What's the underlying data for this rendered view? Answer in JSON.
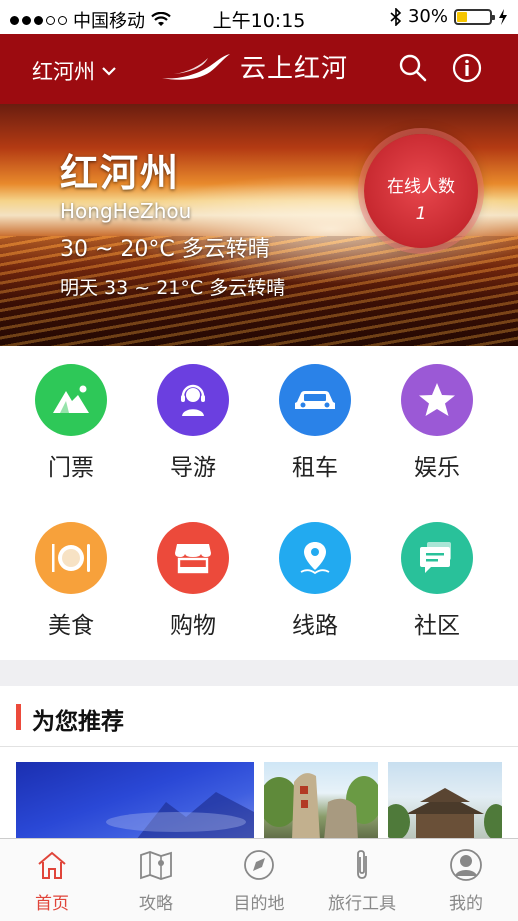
{
  "status_bar": {
    "carrier": "中国移动",
    "time": "上午10:15",
    "battery": "30%"
  },
  "header": {
    "city": "红河州",
    "app_title": "云上红河"
  },
  "banner": {
    "city_name": "红河州",
    "pinyin": "HongHeZhou",
    "today_weather": "30 ~ 20°C 多云转晴",
    "tomorrow_weather": "明天 33 ~ 21°C 多云转晴",
    "online_label": "在线人数",
    "online_count": "1"
  },
  "services": [
    {
      "label": "门票",
      "icon": "mountain-icon",
      "color": "#2ec858"
    },
    {
      "label": "导游",
      "icon": "guide-headset-icon",
      "color": "#6b3fe0"
    },
    {
      "label": "租车",
      "icon": "car-icon",
      "color": "#2a82e8"
    },
    {
      "label": "娱乐",
      "icon": "star-icon",
      "color": "#9b59d6"
    },
    {
      "label": "美食",
      "icon": "dining-icon",
      "color": "#f7a13b"
    },
    {
      "label": "购物",
      "icon": "shop-icon",
      "color": "#ec4a3b"
    },
    {
      "label": "线路",
      "icon": "location-pin-icon",
      "color": "#22aaf0"
    },
    {
      "label": "社区",
      "icon": "chat-icon",
      "color": "#29c19a"
    }
  ],
  "recommend": {
    "title": "为您推荐"
  },
  "tabs": [
    {
      "label": "首页",
      "icon": "home-icon",
      "active": true
    },
    {
      "label": "攻略",
      "icon": "map-icon",
      "active": false
    },
    {
      "label": "目的地",
      "icon": "compass-icon",
      "active": false
    },
    {
      "label": "旅行工具",
      "icon": "paperclip-icon",
      "active": false
    },
    {
      "label": "我的",
      "icon": "user-icon",
      "active": false
    }
  ],
  "colors": {
    "brand_red": "#9c0b10",
    "active_tab": "#e0453a"
  }
}
